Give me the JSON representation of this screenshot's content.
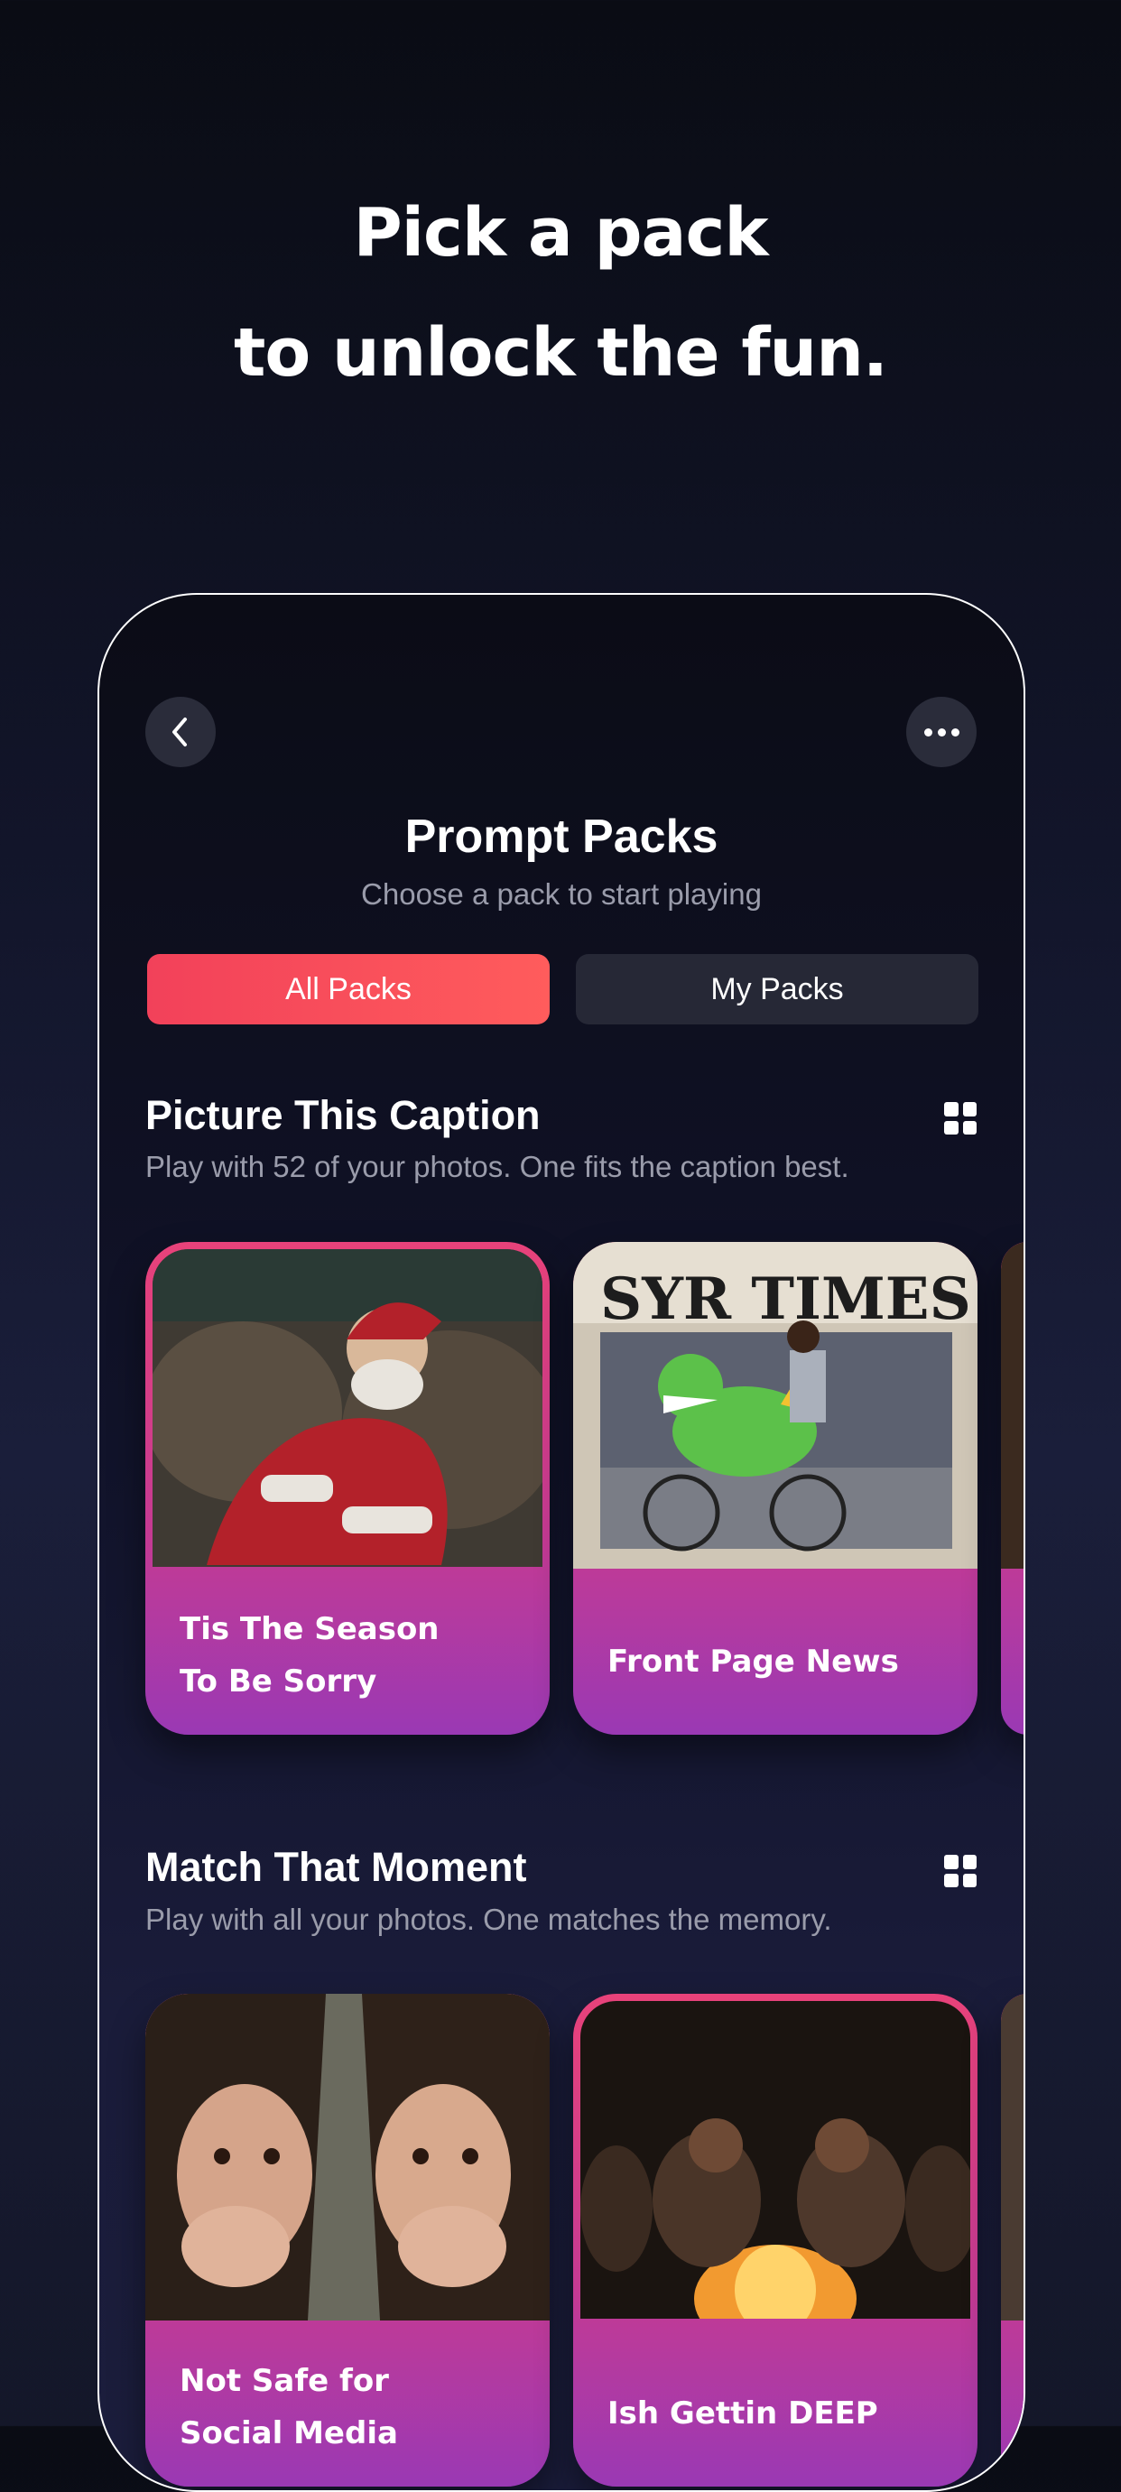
{
  "headline": {
    "line1": "Pick a pack",
    "line2": "to unlock the fun."
  },
  "screen": {
    "title": "Prompt Packs",
    "subtitle": "Choose a pack to start playing",
    "back_icon": "chevron-left-icon",
    "more_icon": "ellipsis-icon",
    "tabs": [
      {
        "label": "All Packs",
        "selected": true
      },
      {
        "label": "My Packs",
        "selected": false
      }
    ]
  },
  "sections": [
    {
      "title": "Picture This Caption",
      "description": "Play with 52 of your photos. One fits the caption best.",
      "icon": "grid-view-icon",
      "cards": [
        {
          "line1": "Tis The Season",
          "line2": "To Be Sorry"
        },
        {
          "line1": "Front Page News",
          "line2": ""
        }
      ]
    },
    {
      "title": "Match That Moment",
      "description": "Play with all your photos. One matches the memory.",
      "icon": "grid-view-icon",
      "cards": [
        {
          "line1": "Not Safe for",
          "line2": "Social Media"
        },
        {
          "line1": "Ish Gettin DEEP",
          "line2": ""
        }
      ]
    }
  ],
  "colors": {
    "accent": "#f2415a",
    "card_top": "#e8427a",
    "card_bottom": "#9a39b4",
    "muted_text": "#9a9cab"
  }
}
